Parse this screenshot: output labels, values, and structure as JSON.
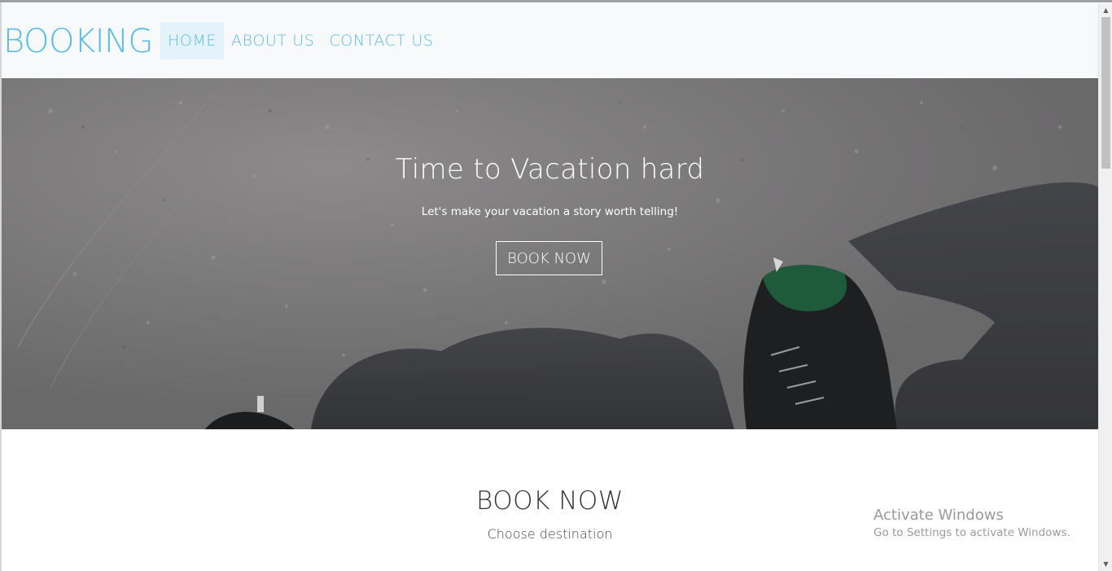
{
  "navbar": {
    "brand": "BOOKING",
    "links": [
      {
        "label": "HOME",
        "active": true
      },
      {
        "label": "ABOUT US",
        "active": false
      },
      {
        "label": "CONTACT US",
        "active": false
      }
    ]
  },
  "hero": {
    "title": "Time to Vacation hard",
    "subtitle": "Let's make your vacation a story worth telling!",
    "button_label": "BOOK NOW"
  },
  "booking": {
    "title": "BOOK NOW",
    "subtitle": "Choose destination"
  },
  "watermark": {
    "title": "Activate Windows",
    "subtitle": "Go to Settings to activate Windows."
  },
  "scrollbar": {
    "up_icon": "▲",
    "down_icon": "▼"
  },
  "colors": {
    "accent": "#5bbce0",
    "active_nav_bg": "#e4f3f9",
    "navbar_bg": "#f7f9fb"
  }
}
